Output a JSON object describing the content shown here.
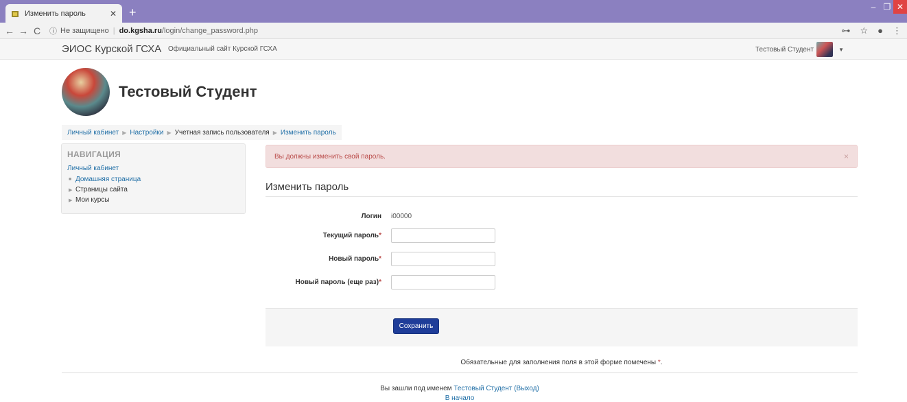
{
  "browser": {
    "tab_title": "Изменить пароль",
    "insecure_label": "Не защищено",
    "url_host": "do.kgsha.ru",
    "url_path": "/login/change_password.php"
  },
  "site": {
    "brand": "ЭИОС Курской ГСХА",
    "official_link": "Официальный сайт Курской ГСХА",
    "user_menu_name": "Тестовый Студент"
  },
  "header": {
    "user_fullname": "Тестовый Студент"
  },
  "breadcrumb": [
    {
      "label": "Личный кабинет"
    },
    {
      "label": "Настройки"
    },
    {
      "label": "Учетная запись пользователя"
    },
    {
      "label": "Изменить пароль"
    }
  ],
  "navigation": {
    "title": "НАВИГАЦИЯ",
    "root": "Личный кабинет",
    "items": [
      {
        "label": "Домашняя страница"
      },
      {
        "label": "Страницы сайта"
      },
      {
        "label": "Мои курсы"
      }
    ]
  },
  "alert": {
    "message": "Вы должны изменить свой пароль.",
    "close": "×"
  },
  "form": {
    "heading": "Изменить пароль",
    "login_label": "Логин",
    "login_value": "i00000",
    "current_password_label": "Текущий пароль",
    "new_password_label": "Новый пароль",
    "new_password_again_label": "Новый пароль (еще раз)",
    "required_mark": "*",
    "save_label": "Сохранить",
    "required_note": "Обязательные для заполнения поля в этой форме помечены",
    "required_note_end": "."
  },
  "footer": {
    "logged_in_prefix": "Вы зашли под именем",
    "user_link": "Тестовый Студент",
    "logout_link": "(Выход)",
    "home_link": "В начало"
  },
  "colors": {
    "tabstrip": "#8b80c0",
    "link": "#1f6ea6",
    "button": "#1f3d99",
    "alert_bg": "#f2dede",
    "alert_text": "#b94a48"
  }
}
